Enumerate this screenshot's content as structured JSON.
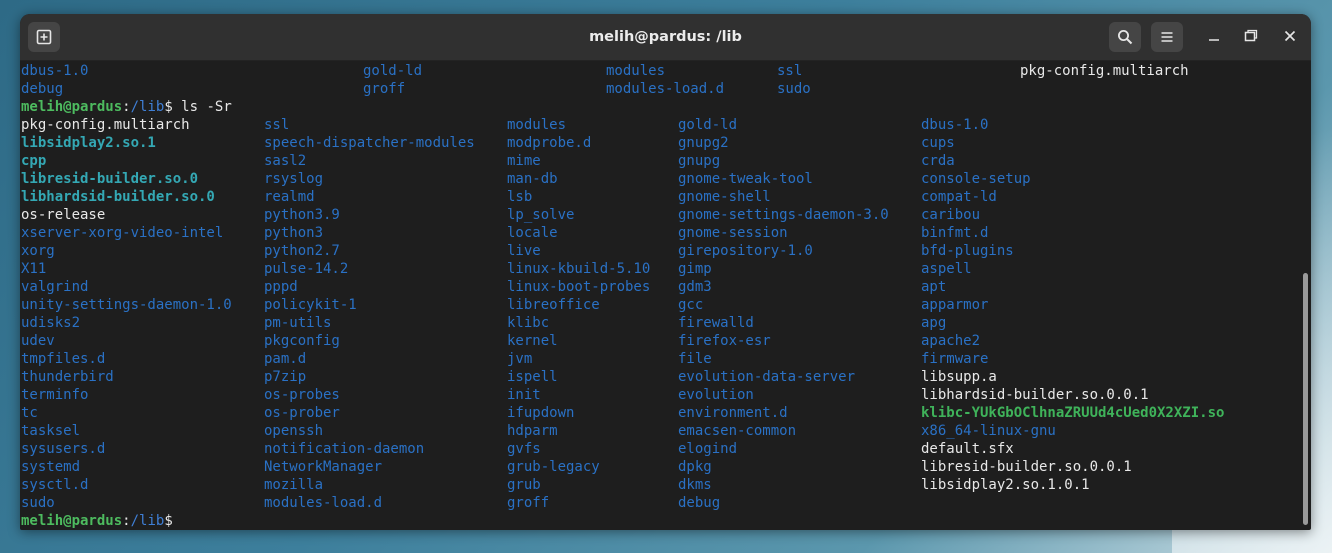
{
  "window": {
    "title": "melih@pardus: /lib",
    "new_tab_icon": "new-tab-icon",
    "search_icon": "search-icon",
    "menu_icon": "hamburger-menu-icon"
  },
  "prompt": {
    "user": "melih@pardus",
    "colon": ":",
    "path": "/lib",
    "symbol": "$"
  },
  "command": " ls -Sr",
  "top_lines": [
    [
      {
        "t": "dbus-1.0",
        "c": "dir"
      },
      {
        "t": "gold-ld",
        "c": "dir"
      },
      {
        "t": "modules",
        "c": "dir"
      },
      {
        "t": "ssl",
        "c": "dir"
      },
      {
        "t": "pkg-config.multiarch",
        "c": "fil"
      }
    ],
    [
      {
        "t": "debug",
        "c": "dir"
      },
      {
        "t": "groff",
        "c": "dir"
      },
      {
        "t": "modules-load.d",
        "c": "dir"
      },
      {
        "t": "sudo",
        "c": "dir"
      }
    ]
  ],
  "listing": {
    "col1": [
      {
        "t": "pkg-config.multiarch",
        "c": "fil"
      },
      {
        "t": "libsidplay2.so.1",
        "c": "lnk"
      },
      {
        "t": "cpp",
        "c": "lnk"
      },
      {
        "t": "libresid-builder.so.0",
        "c": "lnk"
      },
      {
        "t": "libhardsid-builder.so.0",
        "c": "lnk"
      },
      {
        "t": "os-release",
        "c": "fil"
      },
      {
        "t": "xserver-xorg-video-intel",
        "c": "dir"
      },
      {
        "t": "xorg",
        "c": "dir"
      },
      {
        "t": "X11",
        "c": "dir"
      },
      {
        "t": "valgrind",
        "c": "dir"
      },
      {
        "t": "unity-settings-daemon-1.0",
        "c": "dir"
      },
      {
        "t": "udisks2",
        "c": "dir"
      },
      {
        "t": "udev",
        "c": "dir"
      },
      {
        "t": "tmpfiles.d",
        "c": "dir"
      },
      {
        "t": "thunderbird",
        "c": "dir"
      },
      {
        "t": "terminfo",
        "c": "dir"
      },
      {
        "t": "tc",
        "c": "dir"
      },
      {
        "t": "tasksel",
        "c": "dir"
      },
      {
        "t": "sysusers.d",
        "c": "dir"
      },
      {
        "t": "systemd",
        "c": "dir"
      },
      {
        "t": "sysctl.d",
        "c": "dir"
      },
      {
        "t": "sudo",
        "c": "dir"
      }
    ],
    "col2": [
      {
        "t": "ssl",
        "c": "dir"
      },
      {
        "t": "speech-dispatcher-modules",
        "c": "dir"
      },
      {
        "t": "sasl2",
        "c": "dir"
      },
      {
        "t": "rsyslog",
        "c": "dir"
      },
      {
        "t": "realmd",
        "c": "dir"
      },
      {
        "t": "python3.9",
        "c": "dir"
      },
      {
        "t": "python3",
        "c": "dir"
      },
      {
        "t": "python2.7",
        "c": "dir"
      },
      {
        "t": "pulse-14.2",
        "c": "dir"
      },
      {
        "t": "pppd",
        "c": "dir"
      },
      {
        "t": "policykit-1",
        "c": "dir"
      },
      {
        "t": "pm-utils",
        "c": "dir"
      },
      {
        "t": "pkgconfig",
        "c": "dir"
      },
      {
        "t": "pam.d",
        "c": "dir"
      },
      {
        "t": "p7zip",
        "c": "dir"
      },
      {
        "t": "os-probes",
        "c": "dir"
      },
      {
        "t": "os-prober",
        "c": "dir"
      },
      {
        "t": "openssh",
        "c": "dir"
      },
      {
        "t": "notification-daemon",
        "c": "dir"
      },
      {
        "t": "NetworkManager",
        "c": "dir"
      },
      {
        "t": "mozilla",
        "c": "dir"
      },
      {
        "t": "modules-load.d",
        "c": "dir"
      }
    ],
    "col3": [
      {
        "t": "modules",
        "c": "dir"
      },
      {
        "t": "modprobe.d",
        "c": "dir"
      },
      {
        "t": "mime",
        "c": "dir"
      },
      {
        "t": "man-db",
        "c": "dir"
      },
      {
        "t": "lsb",
        "c": "dir"
      },
      {
        "t": "lp_solve",
        "c": "dir"
      },
      {
        "t": "locale",
        "c": "dir"
      },
      {
        "t": "live",
        "c": "dir"
      },
      {
        "t": "linux-kbuild-5.10",
        "c": "dir"
      },
      {
        "t": "linux-boot-probes",
        "c": "dir"
      },
      {
        "t": "libreoffice",
        "c": "dir"
      },
      {
        "t": "klibc",
        "c": "dir"
      },
      {
        "t": "kernel",
        "c": "dir"
      },
      {
        "t": "jvm",
        "c": "dir"
      },
      {
        "t": "ispell",
        "c": "dir"
      },
      {
        "t": "init",
        "c": "dir"
      },
      {
        "t": "ifupdown",
        "c": "dir"
      },
      {
        "t": "hdparm",
        "c": "dir"
      },
      {
        "t": "gvfs",
        "c": "dir"
      },
      {
        "t": "grub-legacy",
        "c": "dir"
      },
      {
        "t": "grub",
        "c": "dir"
      },
      {
        "t": "groff",
        "c": "dir"
      }
    ],
    "col4": [
      {
        "t": "gold-ld",
        "c": "dir"
      },
      {
        "t": "gnupg2",
        "c": "dir"
      },
      {
        "t": "gnupg",
        "c": "dir"
      },
      {
        "t": "gnome-tweak-tool",
        "c": "dir"
      },
      {
        "t": "gnome-shell",
        "c": "dir"
      },
      {
        "t": "gnome-settings-daemon-3.0",
        "c": "dir"
      },
      {
        "t": "gnome-session",
        "c": "dir"
      },
      {
        "t": "girepository-1.0",
        "c": "dir"
      },
      {
        "t": "gimp",
        "c": "dir"
      },
      {
        "t": "gdm3",
        "c": "dir"
      },
      {
        "t": "gcc",
        "c": "dir"
      },
      {
        "t": "firewalld",
        "c": "dir"
      },
      {
        "t": "firefox-esr",
        "c": "dir"
      },
      {
        "t": "file",
        "c": "dir"
      },
      {
        "t": "evolution-data-server",
        "c": "dir"
      },
      {
        "t": "evolution",
        "c": "dir"
      },
      {
        "t": "environment.d",
        "c": "dir"
      },
      {
        "t": "emacsen-common",
        "c": "dir"
      },
      {
        "t": "elogind",
        "c": "dir"
      },
      {
        "t": "dpkg",
        "c": "dir"
      },
      {
        "t": "dkms",
        "c": "dir"
      },
      {
        "t": "debug",
        "c": "dir"
      }
    ],
    "col5": [
      {
        "t": "dbus-1.0",
        "c": "dir"
      },
      {
        "t": "cups",
        "c": "dir"
      },
      {
        "t": "crda",
        "c": "dir"
      },
      {
        "t": "console-setup",
        "c": "dir"
      },
      {
        "t": "compat-ld",
        "c": "dir"
      },
      {
        "t": "caribou",
        "c": "dir"
      },
      {
        "t": "binfmt.d",
        "c": "dir"
      },
      {
        "t": "bfd-plugins",
        "c": "dir"
      },
      {
        "t": "aspell",
        "c": "dir"
      },
      {
        "t": "apt",
        "c": "dir"
      },
      {
        "t": "apparmor",
        "c": "dir"
      },
      {
        "t": "apg",
        "c": "dir"
      },
      {
        "t": "apache2",
        "c": "dir"
      },
      {
        "t": "firmware",
        "c": "dir"
      },
      {
        "t": "libsupp.a",
        "c": "fil"
      },
      {
        "t": "libhardsid-builder.so.0.0.1",
        "c": "fil"
      },
      {
        "t": "klibc-YUkGbOClhnaZRUUd4cUed0X2XZI.so",
        "c": "exe"
      },
      {
        "t": "x86_64-linux-gnu",
        "c": "dir"
      },
      {
        "t": "default.sfx",
        "c": "fil"
      },
      {
        "t": "libresid-builder.so.0.0.1",
        "c": "fil"
      },
      {
        "t": "libsidplay2.so.1.0.1",
        "c": "fil"
      }
    ]
  }
}
